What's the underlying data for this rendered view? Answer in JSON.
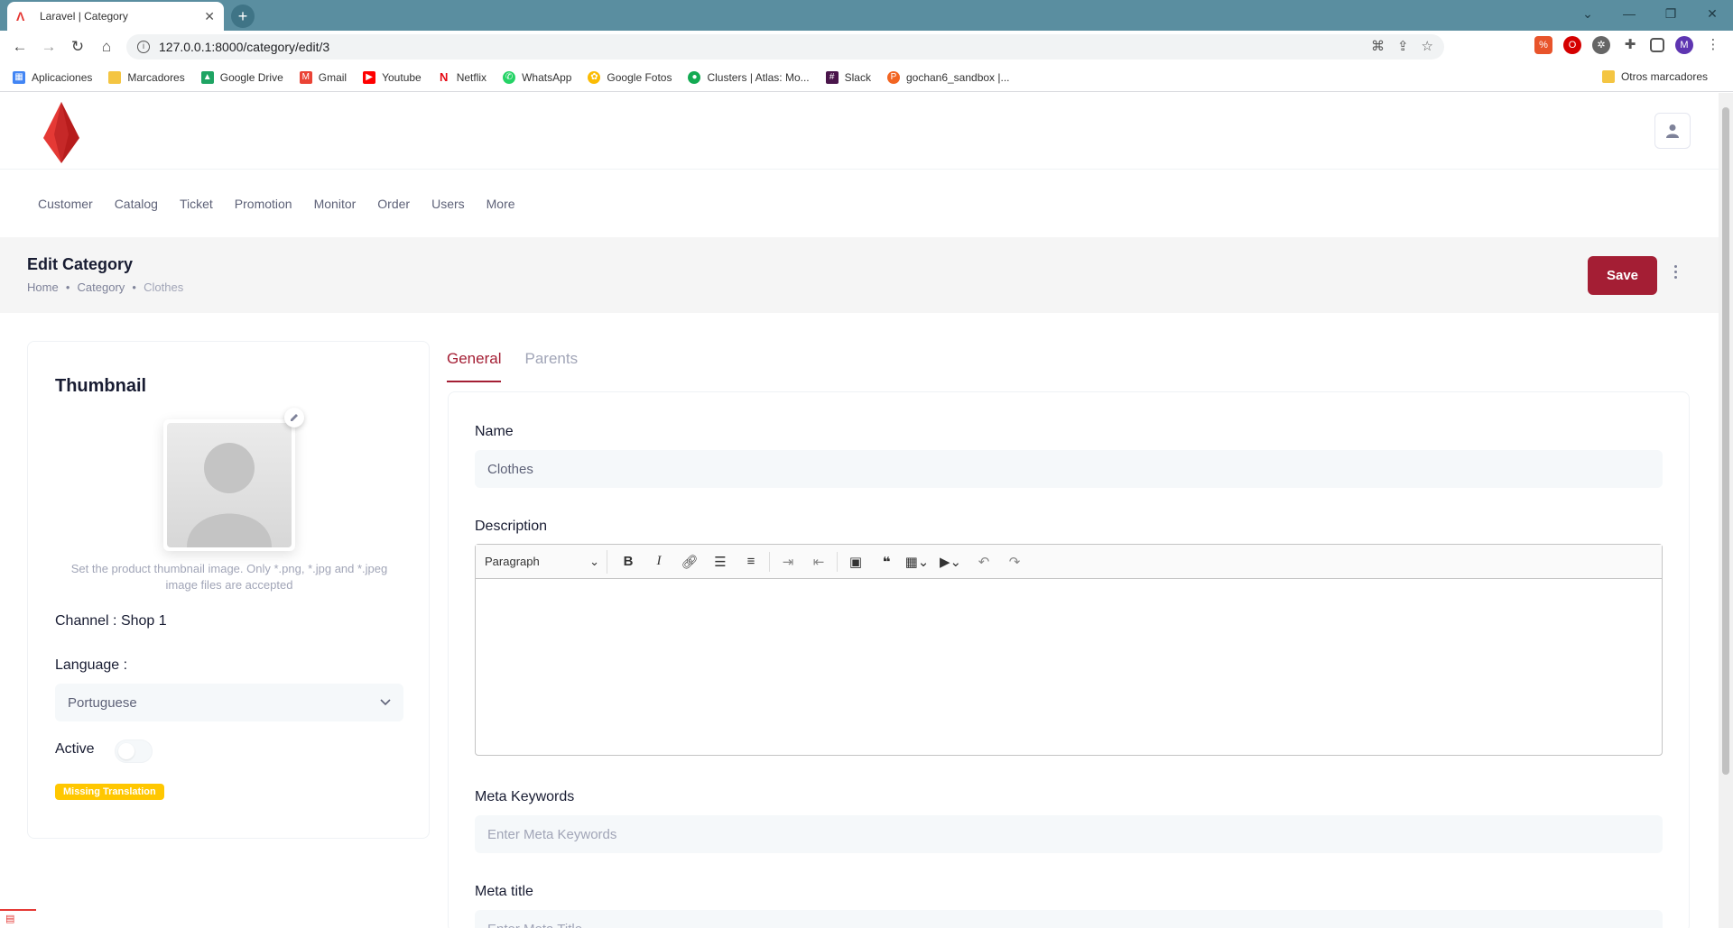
{
  "browser": {
    "tab_title": "Laravel | Category",
    "url": "127.0.0.1:8000/category/edit/3",
    "bookmarks": [
      "Aplicaciones",
      "Marcadores",
      "Google Drive",
      "Gmail",
      "Youtube",
      "Netflix",
      "WhatsApp",
      "Google Fotos",
      "Clusters | Atlas: Mo...",
      "Slack",
      "gochan6_sandbox |..."
    ],
    "other_bookmarks": "Otros marcadores",
    "profile_initial": "M"
  },
  "menu": [
    "Customer",
    "Catalog",
    "Ticket",
    "Promotion",
    "Monitor",
    "Order",
    "Users",
    "More"
  ],
  "page": {
    "title": "Edit Category",
    "breadcrumb": [
      "Home",
      "Category",
      "Clothes"
    ],
    "save_label": "Save"
  },
  "thumbnail": {
    "heading": "Thumbnail",
    "hint": "Set the product thumbnail image. Only *.png, *.jpg and *.jpeg image files are accepted",
    "channel": "Channel : Shop 1",
    "language_label": "Language :",
    "language_value": "Portuguese",
    "active_label": "Active",
    "active": false,
    "badge": "Missing Translation"
  },
  "tabs": [
    "General",
    "Parents"
  ],
  "form": {
    "name_label": "Name",
    "name_value": "Clothes",
    "description_label": "Description",
    "editor_format": "Paragraph",
    "meta_keywords_label": "Meta Keywords",
    "meta_keywords_placeholder": "Enter Meta Keywords",
    "meta_title_label": "Meta title",
    "meta_title_placeholder": "Enter Meta Title"
  },
  "colors": {
    "brand": "#a41e34",
    "badge": "#ffc700",
    "tabstrip": "#5a8ea0"
  }
}
